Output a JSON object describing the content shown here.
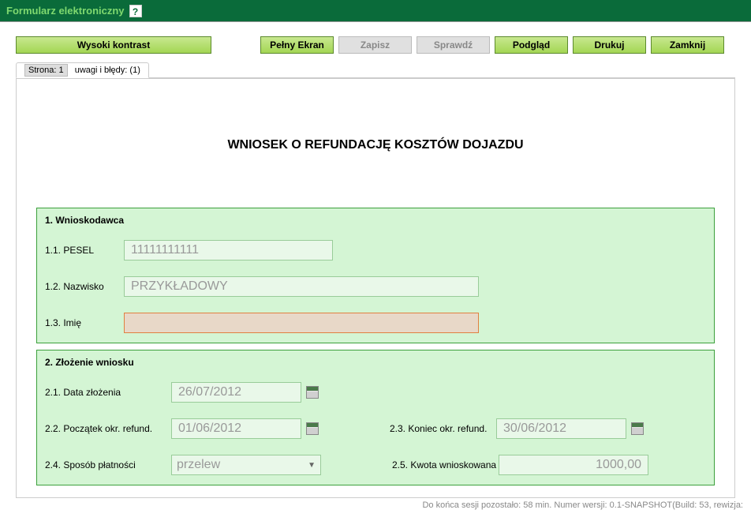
{
  "header": {
    "title": "Formularz elektroniczny",
    "help": "?"
  },
  "toolbar": {
    "contrast": "Wysoki kontrast",
    "fullscreen": "Pełny Ekran",
    "save": "Zapisz",
    "check": "Sprawdź",
    "preview": "Podgląd",
    "print": "Drukuj",
    "close": "Zamknij"
  },
  "tabs": {
    "page_prefix": "Strona: 1",
    "errors": "uwagi i błędy: (1)"
  },
  "form": {
    "title": "WNIOSEK O REFUNDACJĘ KOSZTÓW DOJAZDU",
    "section1": {
      "title": "1. Wnioskodawca",
      "pesel_label": "1.1. PESEL",
      "pesel_value": "11111111111",
      "nazwisko_label": "1.2. Nazwisko",
      "nazwisko_value": "PRZYKŁADOWY",
      "imie_label": "1.3. Imię",
      "imie_value": ""
    },
    "section2": {
      "title": "2. Złożenie wniosku",
      "data_zlozenia_label": "2.1. Data złożenia",
      "data_zlozenia_value": "26/07/2012",
      "poczatek_label": "2.2. Początek okr. refund.",
      "poczatek_value": "01/06/2012",
      "koniec_label": "2.3. Koniec okr. refund.",
      "koniec_value": "30/06/2012",
      "sposob_label": "2.4. Sposób płatności",
      "sposob_value": "przelew",
      "kwota_label": "2.5. Kwota wnioskowana",
      "kwota_value": "1000,00"
    }
  },
  "status": "Do końca sesji pozostało: 58 min.   Numer wersji: 0.1-SNAPSHOT(Build: 53, rewizja:"
}
